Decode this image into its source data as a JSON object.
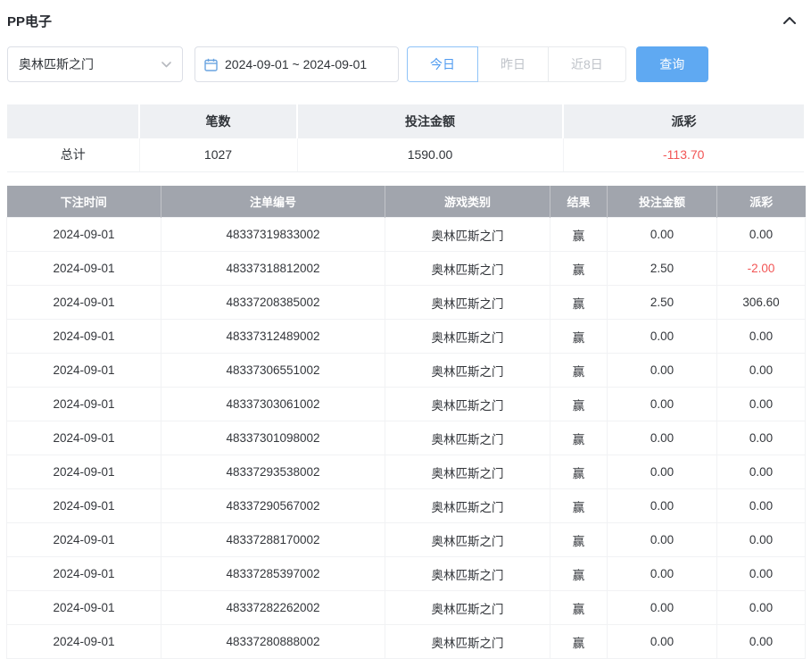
{
  "panel": {
    "title": "PP电子"
  },
  "filters": {
    "game_select": {
      "value": "奥林匹斯之门"
    },
    "date_range": {
      "value": "2024-09-01 ~ 2024-09-01"
    },
    "quick_buttons": [
      {
        "label": "今日",
        "active": true
      },
      {
        "label": "昨日",
        "active": false
      },
      {
        "label": "近8日",
        "active": false
      }
    ],
    "search_label": "查询"
  },
  "summary": {
    "headers": [
      "",
      "笔数",
      "投注金额",
      "派彩"
    ],
    "row_label": "总计",
    "count": "1027",
    "bet_amount": "1590.00",
    "payout": "-113.70"
  },
  "table": {
    "headers": [
      "下注时间",
      "注单编号",
      "游戏类别",
      "结果",
      "投注金额",
      "派彩"
    ],
    "rows": [
      [
        "2024-09-01",
        "48337319833002",
        "奥林匹斯之门",
        "赢",
        "0.00",
        "0.00"
      ],
      [
        "2024-09-01",
        "48337318812002",
        "奥林匹斯之门",
        "赢",
        "2.50",
        "-2.00"
      ],
      [
        "2024-09-01",
        "48337208385002",
        "奥林匹斯之门",
        "赢",
        "2.50",
        "306.60"
      ],
      [
        "2024-09-01",
        "48337312489002",
        "奥林匹斯之门",
        "赢",
        "0.00",
        "0.00"
      ],
      [
        "2024-09-01",
        "48337306551002",
        "奥林匹斯之门",
        "赢",
        "0.00",
        "0.00"
      ],
      [
        "2024-09-01",
        "48337303061002",
        "奥林匹斯之门",
        "赢",
        "0.00",
        "0.00"
      ],
      [
        "2024-09-01",
        "48337301098002",
        "奥林匹斯之门",
        "赢",
        "0.00",
        "0.00"
      ],
      [
        "2024-09-01",
        "48337293538002",
        "奥林匹斯之门",
        "赢",
        "0.00",
        "0.00"
      ],
      [
        "2024-09-01",
        "48337290567002",
        "奥林匹斯之门",
        "赢",
        "0.00",
        "0.00"
      ],
      [
        "2024-09-01",
        "48337288170002",
        "奥林匹斯之门",
        "赢",
        "0.00",
        "0.00"
      ],
      [
        "2024-09-01",
        "48337285397002",
        "奥林匹斯之门",
        "赢",
        "0.00",
        "0.00"
      ],
      [
        "2024-09-01",
        "48337282262002",
        "奥林匹斯之门",
        "赢",
        "0.00",
        "0.00"
      ],
      [
        "2024-09-01",
        "48337280888002",
        "奥林匹斯之门",
        "赢",
        "0.00",
        "0.00"
      ]
    ]
  },
  "colors": {
    "accent": "#5fa9f2",
    "active-blue": "#4f9bf0",
    "table-header-bg": "#a1a5ad",
    "negative": "#f25555"
  }
}
